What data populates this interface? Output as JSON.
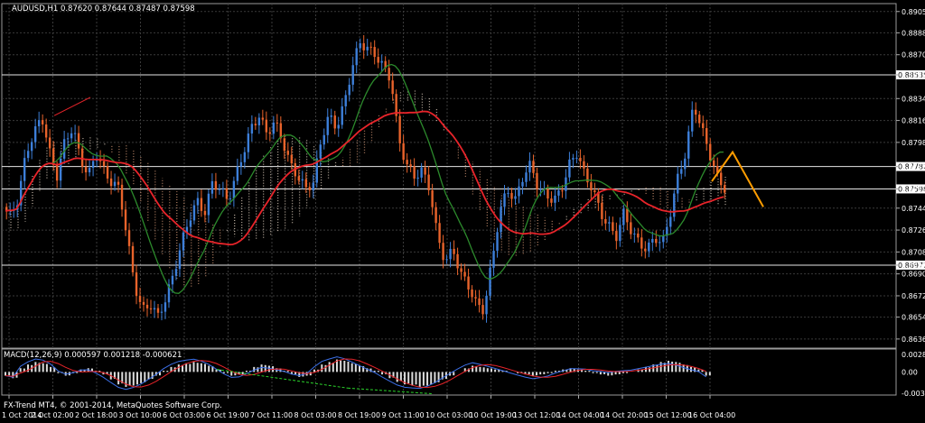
{
  "header": {
    "symbol_line": "AUDUSD,H1  0.87620 0.87644 0.87487 0.87598",
    "indicator_line": "MACD(12,26,9) 0.000597 0.001218 -0.000621",
    "copyright": "FX-Trend MT4, © 2001-2014, MetaQuotes Software Corp."
  },
  "colors": {
    "background": "#000000",
    "grid": "#3a3a3a",
    "bull_candle": "#3d7fd9",
    "bear_candle": "#e8632b",
    "ma_slow": "#e8242a",
    "ma_fast": "#2c8a2c",
    "cloud_up": "#d8c8b8",
    "cloud_down": "#c89070",
    "projection": "#ff9d00",
    "macd_hist": "#dcdcdc",
    "macd_line": "#3b6fe8",
    "signal_line": "#e8242a",
    "divergence": "#2bd62b"
  },
  "chart_data": {
    "type": "line",
    "price_axis": {
      "ticks": [
        "0.89055",
        "0.88880",
        "0.88700",
        "0.88535",
        "0.88340",
        "0.88160",
        "0.87980",
        "0.87782",
        "0.87598",
        "0.87440",
        "0.87260",
        "0.87080",
        "0.86972",
        "0.86900",
        "0.86720",
        "0.86545",
        "0.86365"
      ],
      "range": [
        0.8629,
        0.8912
      ]
    },
    "horizontal_levels": [
      0.88535,
      0.87782,
      0.87598,
      0.86972
    ],
    "time_axis": [
      "1 Oct 2014",
      "2 Oct 02:00",
      "2 Oct 18:00",
      "3 Oct 10:00",
      "6 Oct 03:00",
      "6 Oct 19:00",
      "7 Oct 11:00",
      "8 Oct 03:00",
      "8 Oct 19:00",
      "9 Oct 11:00",
      "10 Oct 03:00",
      "10 Oct 19:00",
      "13 Oct 12:00",
      "14 Oct 04:00",
      "14 Oct 20:00",
      "15 Oct 12:00",
      "16 Oct 04:00"
    ],
    "price_path": [
      0.8745,
      0.8738,
      0.8752,
      0.879,
      0.8805,
      0.882,
      0.879,
      0.877,
      0.88,
      0.881,
      0.8785,
      0.877,
      0.879,
      0.8775,
      0.8765,
      0.876,
      0.872,
      0.868,
      0.866,
      0.8665,
      0.8655,
      0.867,
      0.869,
      0.8715,
      0.8735,
      0.875,
      0.874,
      0.8765,
      0.876,
      0.875,
      0.877,
      0.879,
      0.881,
      0.882,
      0.8805,
      0.8815,
      0.88,
      0.878,
      0.877,
      0.876,
      0.8765,
      0.88,
      0.882,
      0.881,
      0.883,
      0.886,
      0.888,
      0.8875,
      0.887,
      0.886,
      0.885,
      0.88,
      0.878,
      0.877,
      0.8775,
      0.876,
      0.872,
      0.87,
      0.871,
      0.869,
      0.868,
      0.8665,
      0.866,
      0.87,
      0.874,
      0.876,
      0.875,
      0.877,
      0.878,
      0.876,
      0.8755,
      0.875,
      0.876,
      0.878,
      0.879,
      0.877,
      0.876,
      0.874,
      0.873,
      0.872,
      0.874,
      0.8725,
      0.8715,
      0.871,
      0.872,
      0.8715,
      0.874,
      0.877,
      0.879,
      0.883,
      0.881,
      0.879,
      0.877,
      0.876
    ],
    "macd": {
      "axis": [
        "0.002814",
        "0.00",
        "-0.003427"
      ],
      "range": [
        -0.003427,
        0.002814
      ],
      "histogram": [
        -0.0006,
        -0.001,
        0.0006,
        0.0012,
        0.0016,
        0.0014,
        0.0008,
        -0.0002,
        -0.0006,
        -0.0002,
        0.0004,
        0.0006,
        0.0002,
        -0.0004,
        -0.0012,
        -0.002,
        -0.0024,
        -0.0022,
        -0.0018,
        -0.0012,
        -0.0006,
        0.0002,
        0.0008,
        0.0012,
        0.0014,
        0.0016,
        0.0014,
        0.001,
        0.0004,
        -0.0002,
        -0.0006,
        -0.0004,
        0.0002,
        0.0008,
        0.0012,
        0.001,
        0.0006,
        0.0002,
        -0.0004,
        -0.0008,
        -0.0006,
        0.0004,
        0.0012,
        0.0016,
        0.002,
        0.0018,
        0.0014,
        0.001,
        0.0006,
        0.0002,
        -0.0004,
        -0.001,
        -0.0016,
        -0.002,
        -0.0022,
        -0.0024,
        -0.0022,
        -0.0018,
        -0.0012,
        -0.0006,
        0.0,
        0.0006,
        0.001,
        0.0008,
        0.0006,
        0.0004,
        0.0002,
        0.0,
        -0.0002,
        -0.0004,
        -0.0006,
        -0.0004,
        -0.0002,
        0.0002,
        0.0004,
        0.0006,
        0.0004,
        0.0002,
        -0.0002,
        -0.0004,
        -0.0006,
        -0.0004,
        -0.0002,
        0.0,
        0.0004,
        0.0008,
        0.0012,
        0.0016,
        0.0018,
        0.0016,
        0.0012,
        0.0008,
        0.0004,
        -0.0006
      ]
    }
  }
}
